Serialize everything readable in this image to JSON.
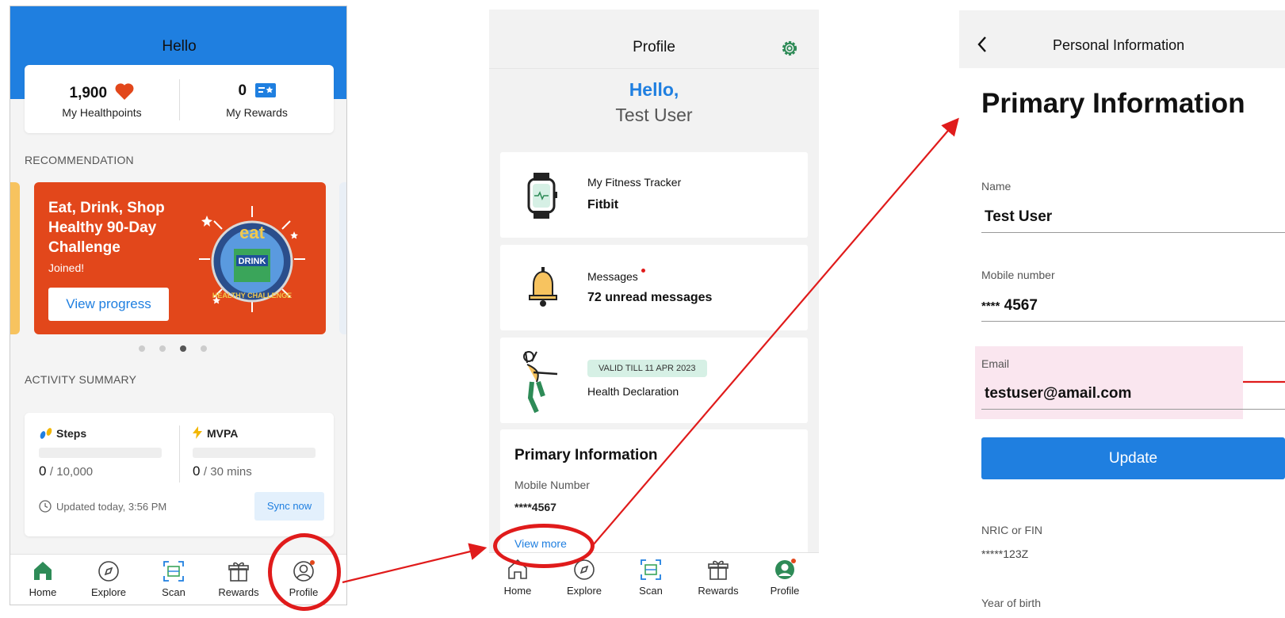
{
  "screen1": {
    "title": "Hello",
    "healthpoints_value": "1,900",
    "healthpoints_label": "My Healthpoints",
    "rewards_value": "0",
    "rewards_label": "My Rewards",
    "recommendation_header": "RECOMMENDATION",
    "promo_title": "Eat, Drink, Shop Healthy 90-Day Challenge",
    "promo_status": "Joined!",
    "promo_button": "View progress",
    "badge_text_top": "eat",
    "badge_text_mid": "DRINK",
    "badge_text_bottom": "HEALTHY CHALLENGE",
    "activity_header": "ACTIVITY SUMMARY",
    "steps_label": "Steps",
    "steps_value": "0",
    "steps_goal": "/ 10,000",
    "steps_progress": 0,
    "mvpa_label": "MVPA",
    "mvpa_value": "0",
    "mvpa_goal": "/ 30 mins",
    "mvpa_progress": 0,
    "updated_text": "Updated today, 3:56 PM",
    "sync_button": "Sync now",
    "carousel_pages": 4,
    "carousel_active": 3,
    "nav": [
      "Home",
      "Explore",
      "Scan",
      "Rewards",
      "Profile"
    ],
    "active_nav": "Home"
  },
  "screen2": {
    "title": "Profile",
    "greeting": "Hello,",
    "username": "Test User",
    "tracker_label": "My Fitness Tracker",
    "tracker_value": "Fitbit",
    "messages_label": "Messages",
    "messages_value": "72 unread messages",
    "valid_badge": "VALID TILL 11 APR 2023",
    "health_declaration": "Health Declaration",
    "primary_title": "Primary Information",
    "mobile_label": "Mobile Number",
    "mobile_value": "****4567",
    "view_more": "View more",
    "nav": [
      "Home",
      "Explore",
      "Scan",
      "Rewards",
      "Profile"
    ],
    "active_nav": "Profile"
  },
  "screen3": {
    "title": "Personal Information",
    "heading": "Primary Information",
    "name_label": "Name",
    "name_value": "Test User",
    "mobile_label": "Mobile number",
    "mobile_mask": "****",
    "mobile_value": "4567",
    "email_label": "Email",
    "email_value": "testuser@amail.com",
    "update_button": "Update",
    "nric_label": "NRIC or FIN",
    "nric_value": "*****123Z",
    "yob_label": "Year of birth"
  },
  "colors": {
    "brand_blue": "#1f7fe0",
    "promo_orange": "#e2471b",
    "annotation_red": "#e01b1b",
    "nav_active_green": "#2e8b57",
    "highlight_pink": "#fae6ef"
  }
}
